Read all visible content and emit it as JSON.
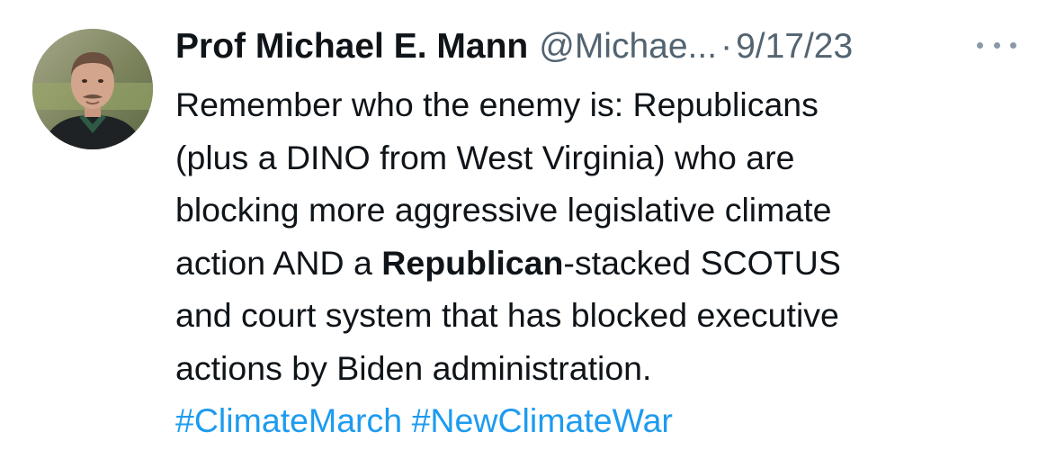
{
  "author": {
    "display_name": "Prof Michael E. Mann",
    "handle": "@Michae...",
    "separator": "·",
    "date": "9/17/23"
  },
  "tweet": {
    "line1": "Remember who the enemy is: Republicans",
    "line2": "(plus a DINO from West Virginia) who are",
    "line3": "blocking more aggressive legislative climate",
    "line4_pre": "action AND a ",
    "line4_bold": "Republican",
    "line4_post": "-stacked SCOTUS",
    "line5": "and court system that has blocked executive",
    "line6": "actions by Biden administration.",
    "hashtags": [
      "#ClimateMarch",
      "#NewClimateWar"
    ]
  },
  "colors": {
    "text": "#0f1419",
    "secondary": "#536471",
    "link": "#1d9bf0"
  },
  "icons": {
    "more": "more-horizontal-icon",
    "avatar": "profile-photo"
  }
}
